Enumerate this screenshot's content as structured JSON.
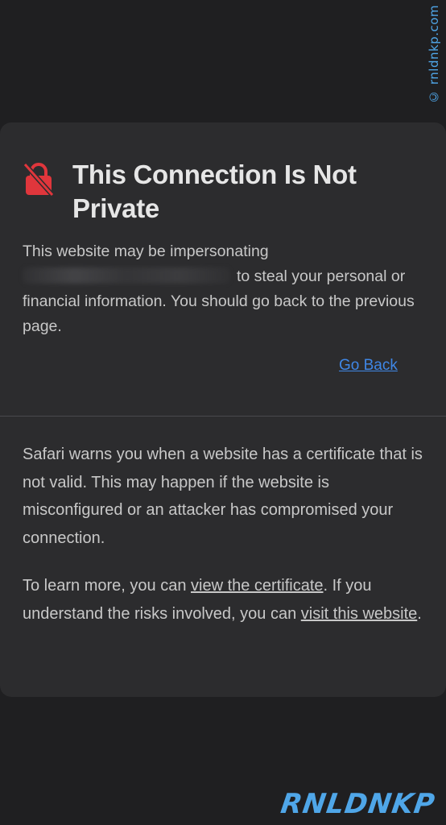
{
  "watermark": {
    "side_text": "© rnldnkp.com",
    "logo_text": "RNLDNKP"
  },
  "warning_card": {
    "title": "This Connection Is Not Private",
    "lock_icon": "lock-slash-icon",
    "warning_line_1": "This website may be impersonating",
    "warning_line_2": "to steal your personal or financial information. You should go back to the previous page.",
    "go_back_label": "Go Back",
    "info_paragraph": "Safari warns you when a website has a certificate that is not valid. This may happen if the website is misconfigured or an attacker has compromised your connection.",
    "learn_more_prefix": "To learn more, you can ",
    "view_certificate_label": "view the certificate",
    "learn_more_middle": ". If you understand the risks involved, you can ",
    "visit_website_label": "visit this website",
    "learn_more_suffix": "."
  },
  "colors": {
    "background": "#1f1f21",
    "card": "#2c2c2e",
    "lock_icon": "#e0363c",
    "link": "#3f87e6",
    "watermark": "#4fa6e8"
  }
}
